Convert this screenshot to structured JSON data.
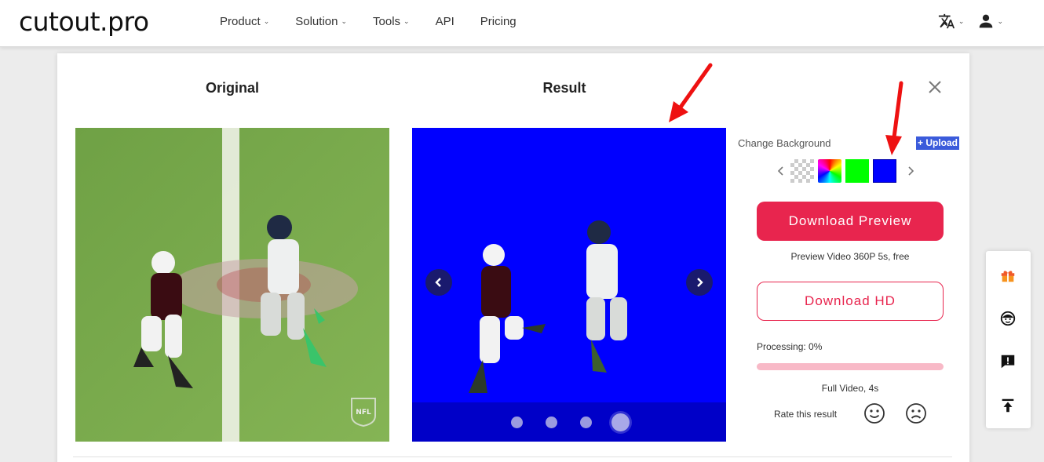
{
  "header": {
    "logo": "cutout.pro",
    "nav": [
      {
        "label": "Product",
        "dropdown": true
      },
      {
        "label": "Solution",
        "dropdown": true
      },
      {
        "label": "Tools",
        "dropdown": true
      },
      {
        "label": "API",
        "dropdown": false
      },
      {
        "label": "Pricing",
        "dropdown": false
      }
    ],
    "icons": [
      "translate-icon",
      "user-icon"
    ]
  },
  "modal": {
    "original_title": "Original",
    "result_title": "Result",
    "carousel": {
      "dot_count": 4,
      "active_index": 3
    },
    "change_background_label": "Change Background",
    "upload_label": "+ Upload",
    "backgrounds": [
      {
        "name": "transparent",
        "color": "checker"
      },
      {
        "name": "rainbow",
        "color": "gradient"
      },
      {
        "name": "green",
        "color": "#00ff00"
      },
      {
        "name": "blue",
        "color": "#0000ff"
      }
    ],
    "download_preview_label": "Download Preview",
    "preview_note": "Preview Video 360P 5s, free",
    "download_hd_label": "Download HD",
    "processing_label": "Processing: 0%",
    "processing_progress": 0,
    "full_video_note": "Full Video, 4s",
    "rate_label": "Rate this result",
    "watermark": "NFL"
  },
  "colors": {
    "accent": "#e8254e",
    "result_bg": "#0000ff",
    "upload_bg": "#3b5bdb"
  },
  "side_tools": [
    "gift-icon",
    "support-icon",
    "feedback-icon",
    "back-to-top-icon"
  ]
}
